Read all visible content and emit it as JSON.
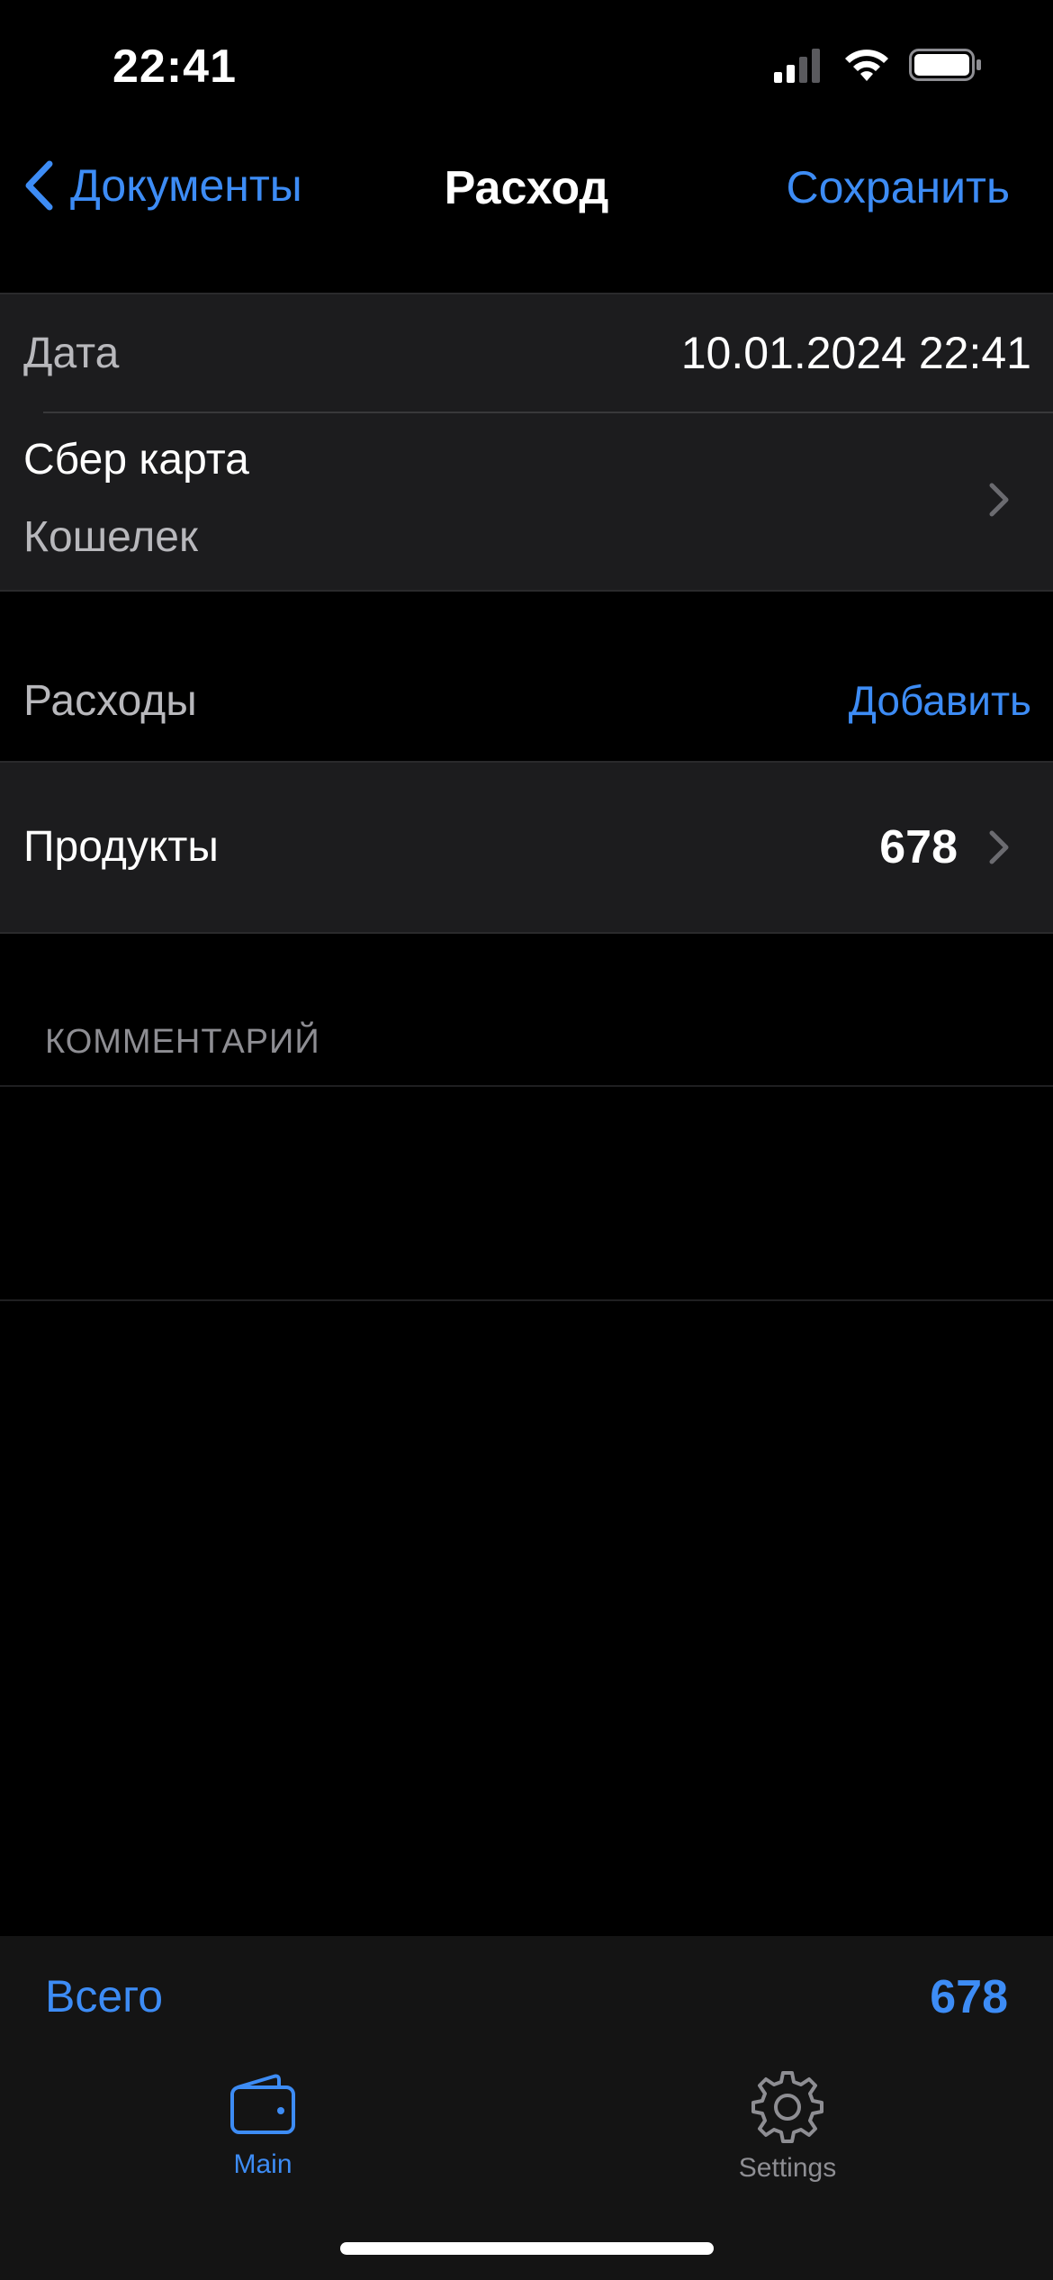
{
  "status_bar": {
    "time": "22:41"
  },
  "nav": {
    "back_label": "Документы",
    "title": "Расход",
    "save_label": "Сохранить"
  },
  "form": {
    "date_label": "Дата",
    "date_value": "10.01.2024 22:41",
    "account_title": "Сбер карта",
    "account_subtitle": "Кошелек"
  },
  "expenses": {
    "header": "Расходы",
    "add_label": "Добавить",
    "items": [
      {
        "name": "Продукты",
        "amount": "678"
      }
    ]
  },
  "comment": {
    "header": "КОММЕНТАРИЙ",
    "text": ""
  },
  "summary": {
    "total_label": "Всего",
    "total_value": "678"
  },
  "tab_bar": {
    "tabs": [
      {
        "label": "Main",
        "icon": "wallet-icon",
        "active": true
      },
      {
        "label": "Settings",
        "icon": "gear-icon",
        "active": false
      }
    ]
  },
  "colors": {
    "accent": "#3d8cf5",
    "background": "#000000",
    "cell": "#1c1c1e",
    "secondary_text": "#8e8e93"
  }
}
